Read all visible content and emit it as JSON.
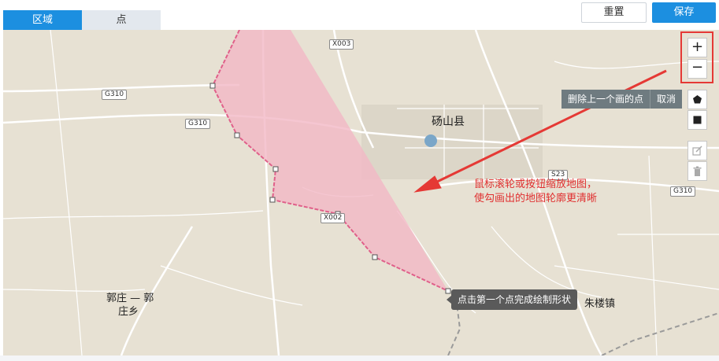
{
  "tabs": {
    "area": "区域",
    "point": "点"
  },
  "toolbar": {
    "reset_label": "重置",
    "save_label": "保存"
  },
  "map": {
    "labels": {
      "county": "砀山县",
      "town_guozhuang_line1": "郭庄 — 郭",
      "town_guozhuang_line2": "庄乡",
      "town_zhulouzhen": "朱楼镇"
    },
    "road_shields": {
      "x003": "X003",
      "g310_a": "G310",
      "g310_b": "G310",
      "g310_c": "G310",
      "s23": "S23",
      "x002": "X002"
    },
    "annotation_line1": "鼠标滚轮或按钮缩放地图，",
    "annotation_line2": "使勾画出的地图轮廓更清晰",
    "tooltip": "点击第一个点完成绘制形状",
    "delete_last_point_label": "删除上一个画的点",
    "cancel_label": "取消",
    "zoom_in_symbol": "+",
    "zoom_out_symbol": "−"
  },
  "icons": {
    "polygon": "pentagon-icon",
    "rectangle": "square-icon",
    "edit": "edit-icon",
    "trash": "trash-icon"
  },
  "colors": {
    "accent": "#1c8fe0",
    "polygon_fill": "#f2b8c6",
    "polygon_stroke": "#e0608a",
    "annotation": "#e03030"
  }
}
